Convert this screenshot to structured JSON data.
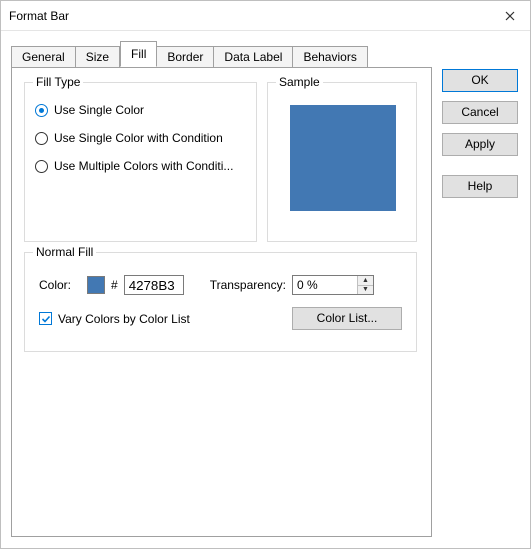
{
  "window": {
    "title": "Format Bar"
  },
  "tabs": {
    "general": "General",
    "size": "Size",
    "fill": "Fill",
    "border": "Border",
    "data_label": "Data Label",
    "behaviors": "Behaviors"
  },
  "buttons": {
    "ok": "OK",
    "cancel": "Cancel",
    "apply": "Apply",
    "help": "Help",
    "color_list": "Color List..."
  },
  "groups": {
    "fill_type": "Fill Type",
    "sample": "Sample",
    "normal_fill": "Normal Fill"
  },
  "fill_type": {
    "option_single": "Use Single Color",
    "option_single_cond": "Use Single Color with Condition",
    "option_multi": "Use Multiple Colors with Conditi..."
  },
  "normal_fill": {
    "color_label": "Color:",
    "hash": "#",
    "hex_value": "4278B3",
    "transparency_label": "Transparency:",
    "transparency_value": "0 %",
    "vary_label": "Vary Colors by Color List"
  },
  "colors": {
    "sample_fill": "#4278b3"
  }
}
